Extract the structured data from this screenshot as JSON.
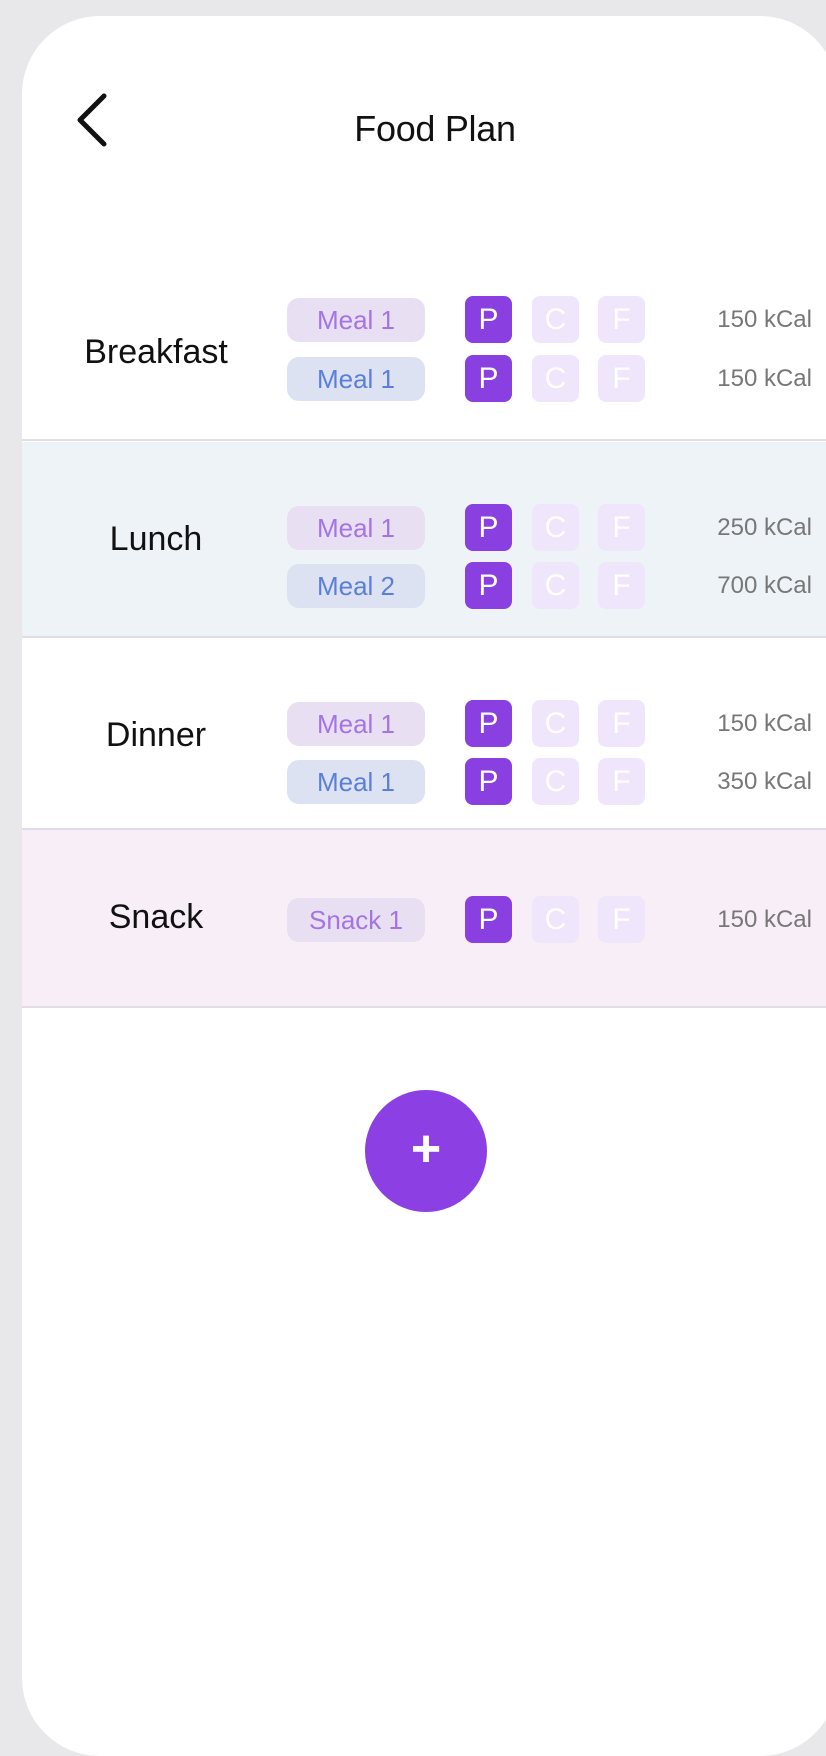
{
  "header": {
    "title": "Food Plan",
    "back_icon": "chevron-left-icon"
  },
  "sections": [
    {
      "name": "Breakfast",
      "rows": [
        {
          "meal": "Meal 1",
          "style": "purple",
          "macros": [
            "P",
            "C",
            "F"
          ],
          "active_macro": "P",
          "kcal": "150 kCal"
        },
        {
          "meal": "Meal 1",
          "style": "blue",
          "macros": [
            "P",
            "C",
            "F"
          ],
          "active_macro": "P",
          "kcal": "150 kCal"
        }
      ]
    },
    {
      "name": "Lunch",
      "rows": [
        {
          "meal": "Meal 1",
          "style": "purple",
          "macros": [
            "P",
            "C",
            "F"
          ],
          "active_macro": "P",
          "kcal": "250 kCal"
        },
        {
          "meal": "Meal 2",
          "style": "blue",
          "macros": [
            "P",
            "C",
            "F"
          ],
          "active_macro": "P",
          "kcal": "700 kCal"
        }
      ]
    },
    {
      "name": "Dinner",
      "rows": [
        {
          "meal": "Meal 1",
          "style": "purple",
          "macros": [
            "P",
            "C",
            "F"
          ],
          "active_macro": "P",
          "kcal": "150 kCal"
        },
        {
          "meal": "Meal 1",
          "style": "blue",
          "macros": [
            "P",
            "C",
            "F"
          ],
          "active_macro": "P",
          "kcal": "350 kCal"
        }
      ]
    },
    {
      "name": "Snack",
      "rows": [
        {
          "meal": "Snack 1",
          "style": "purple",
          "macros": [
            "P",
            "C",
            "F"
          ],
          "active_macro": "P",
          "kcal": "150 kCal"
        }
      ]
    }
  ],
  "add_button": {
    "label": "+",
    "icon": "plus-icon"
  },
  "colors": {
    "accent": "#8a3fe0",
    "macro_inactive": "#efe6fb",
    "lunch_bg": "#eef3f8",
    "snack_bg": "#f8eef8",
    "pill_purple_bg": "#e9dff2",
    "pill_purple_text": "#a574e4",
    "pill_blue_bg": "#dce2f1",
    "pill_blue_text": "#5b7fd8"
  }
}
